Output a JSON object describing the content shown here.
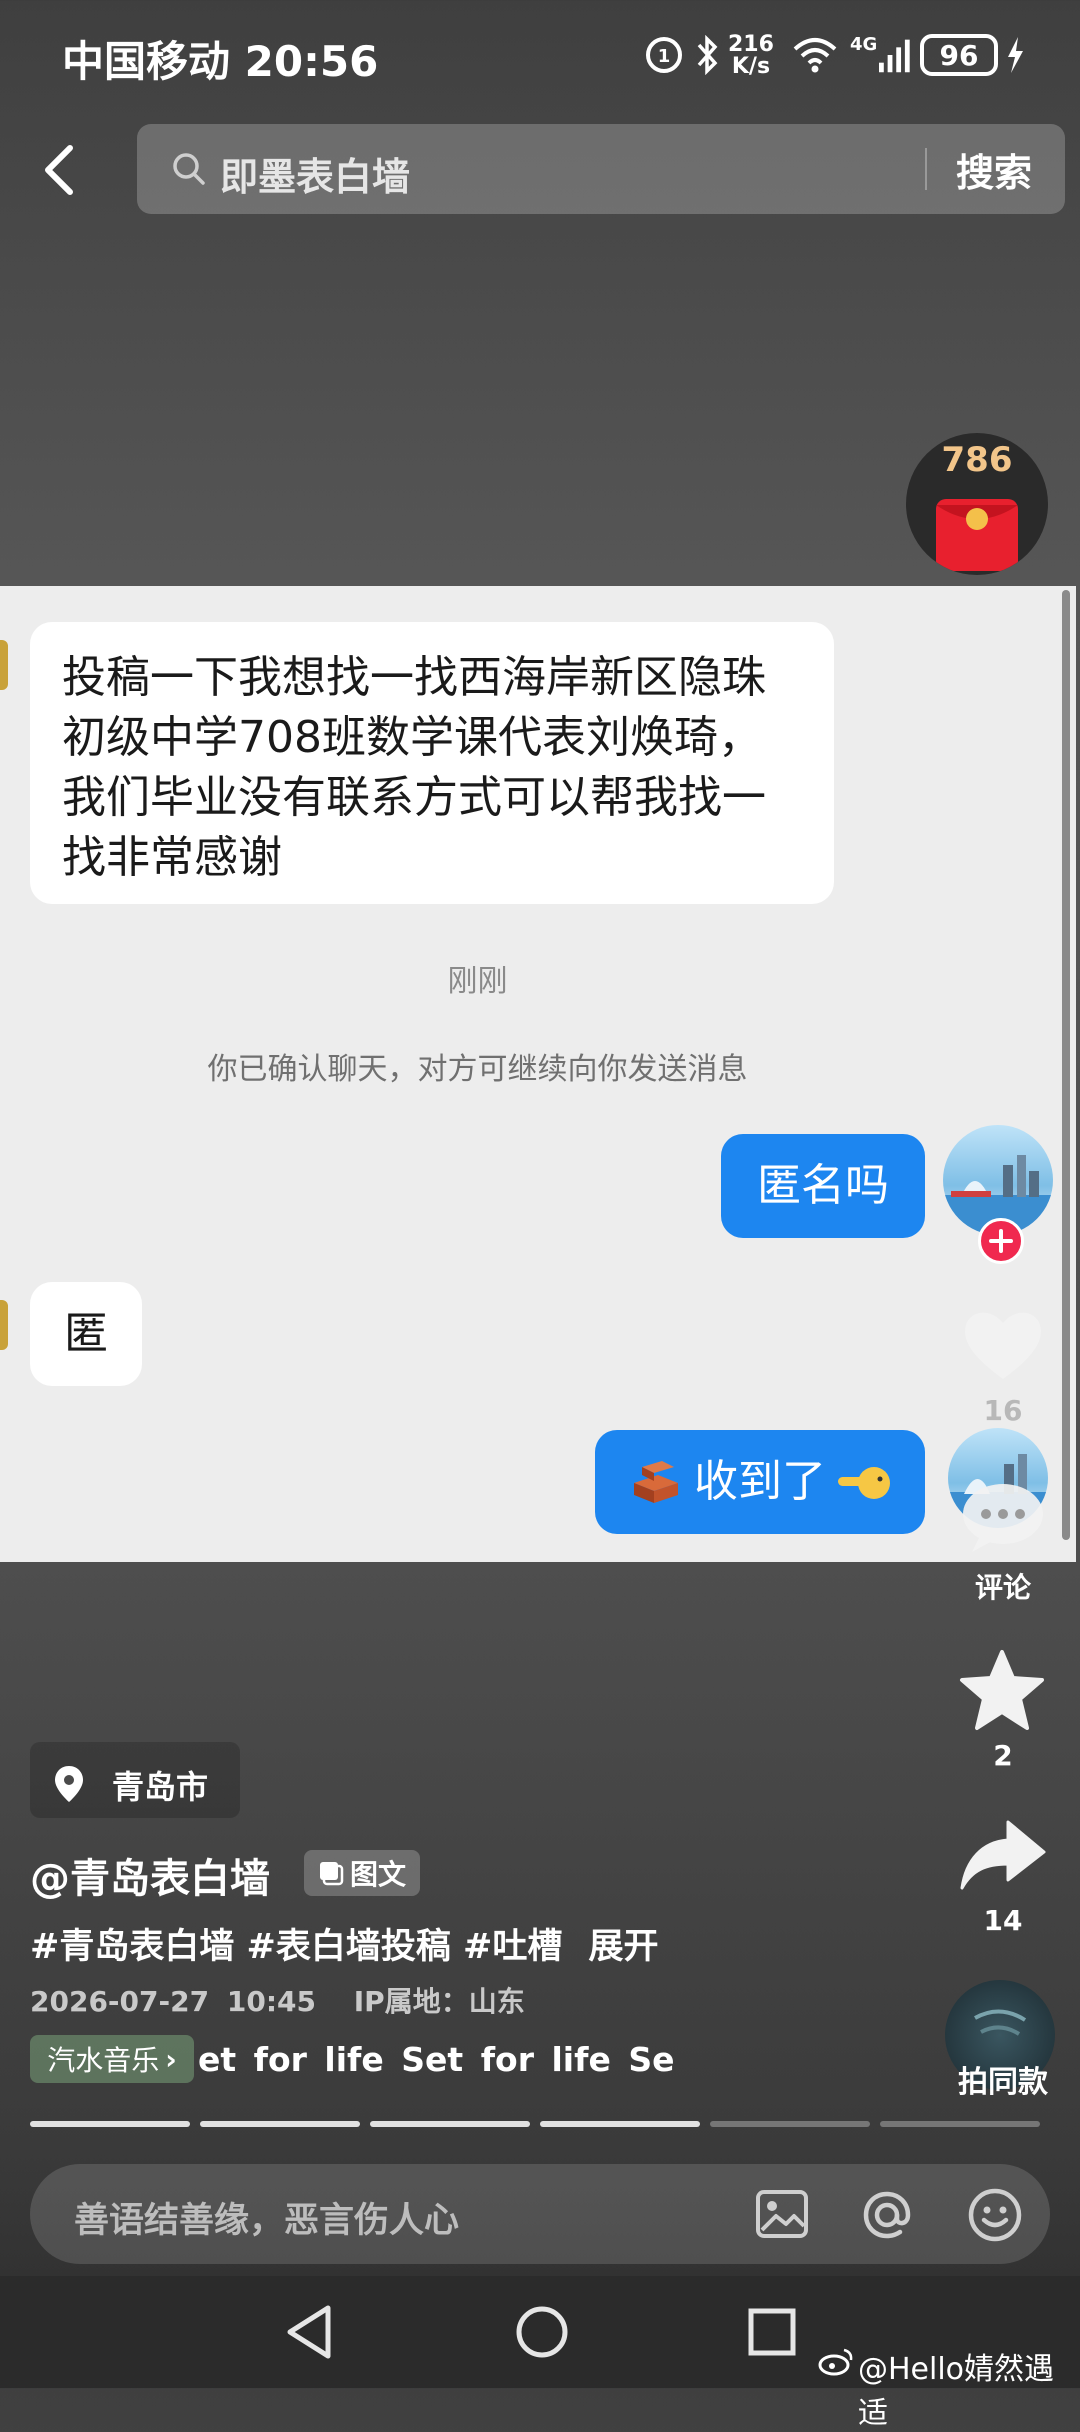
{
  "status_bar": {
    "carrier_time": "中国移动 20:56",
    "network_speed_value": "216",
    "network_speed_unit": "K/s",
    "network_type": "4G",
    "battery": "96"
  },
  "top_bar": {
    "search_placeholder": "即墨表白墙",
    "search_button": "搜索"
  },
  "red_packet": {
    "count": "786"
  },
  "chat": {
    "messages": [
      {
        "side": "left",
        "text": "投稿一下我想找一找西海岸新区隐珠初级中学708班数学课代表刘焕琦，我们毕业没有联系方式可以帮我找一找非常感谢"
      },
      {
        "side": "right",
        "text": "匿名吗"
      },
      {
        "side": "left",
        "text": "匿"
      },
      {
        "side": "right",
        "text": "收到了"
      }
    ],
    "time_label": "刚刚",
    "system_notice": "你已确认聊天，对方可继续向你发送消息"
  },
  "actions": {
    "like_count": "16",
    "comment_label": "评论",
    "favorite_count": "2",
    "share_count": "14",
    "same_style_label": "拍同款"
  },
  "post": {
    "location": "青岛市",
    "author": "@青岛表白墙",
    "type_badge": "图文",
    "tags": "#青岛表白墙 #表白墙投稿 #吐槽",
    "expand": "展开",
    "date": "2026-07-27",
    "time": "10:45",
    "ip_location": "IP属地：山东",
    "music_badge": "汽水音乐",
    "music_chevron": "›",
    "music_scroll": "et for life     Set for life     Se",
    "progress_segments": 6,
    "progress_active": 4
  },
  "comment_bar": {
    "placeholder": "善语结善缘，恶言伤人心"
  },
  "watermark": "@Hello婧然遇适",
  "colors": {
    "bubble_blue": "#1d86f0",
    "follow_red": "#f0294f",
    "chat_bg": "#ededed"
  }
}
